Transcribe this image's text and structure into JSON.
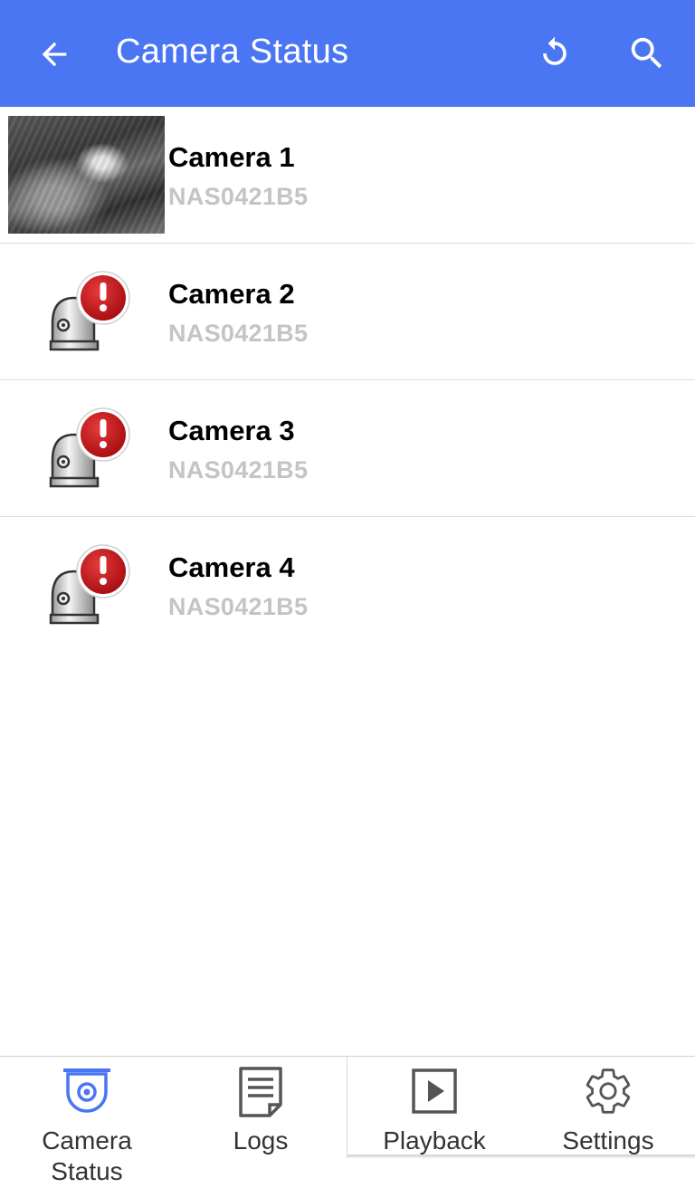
{
  "appbar": {
    "title": "Camera Status",
    "back_icon": "arrow-left-icon",
    "refresh_icon": "refresh-icon",
    "search_icon": "search-icon",
    "background": "#4a75f3"
  },
  "cameras": [
    {
      "name": "Camera 1",
      "device": "NAS0421B5",
      "status": "live-thumbnail"
    },
    {
      "name": "Camera 2",
      "device": "NAS0421B5",
      "status": "error"
    },
    {
      "name": "Camera 3",
      "device": "NAS0421B5",
      "status": "error"
    },
    {
      "name": "Camera 4",
      "device": "NAS0421B5",
      "status": "error"
    }
  ],
  "bottom_nav": {
    "tabs": [
      {
        "label": "Camera\nStatus",
        "icon": "camera-status-icon",
        "active": true
      },
      {
        "label": "Logs",
        "icon": "logs-icon",
        "active": false
      },
      {
        "label": "Playback",
        "icon": "playback-icon",
        "active": false
      },
      {
        "label": "Settings",
        "icon": "gear-icon",
        "active": false
      }
    ],
    "active_color": "#4a75f3",
    "inactive_color": "#555555"
  },
  "colors": {
    "error_badge": "#c4161c",
    "subtitle_gray": "#c4c4c4"
  }
}
